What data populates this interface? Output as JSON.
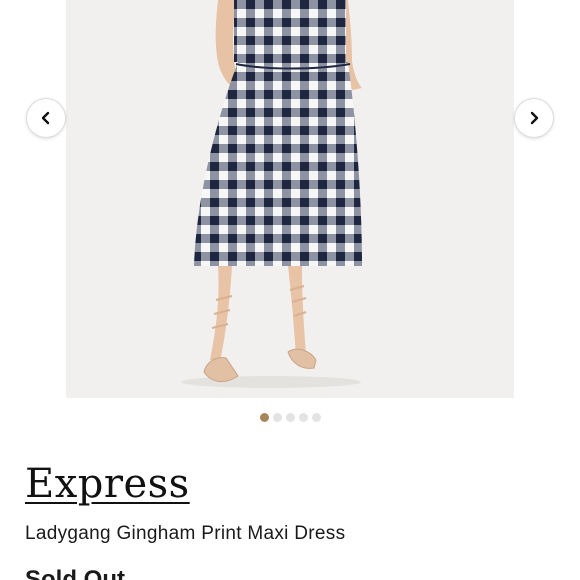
{
  "carousel": {
    "image_description_icon": "product-photo",
    "prev_icon": "chevron-left-icon",
    "next_icon": "chevron-right-icon",
    "slide_count": 5,
    "active_slide": 1,
    "active_dot_color": "#a8855c",
    "inactive_dot_color": "#e3e3e3"
  },
  "listing": {
    "brand": "Express",
    "title": "Ladygang Gingham Print Maxi Dress",
    "status": "Sold Out"
  }
}
